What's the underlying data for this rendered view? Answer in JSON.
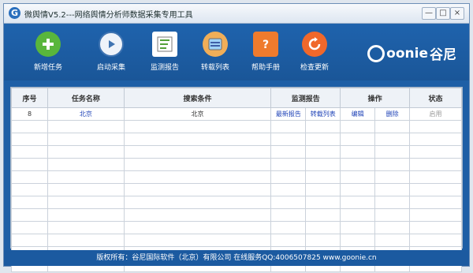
{
  "window": {
    "title": "微舆情V5.2---网络舆情分析师数据采集专用工具",
    "minimize": "—",
    "maximize": "□",
    "close": "×"
  },
  "toolbar": [
    {
      "label": "新增任务",
      "icon": "plus-icon",
      "color": "#59b63c"
    },
    {
      "label": "启动采集",
      "icon": "play-icon",
      "color": "#3f74b2"
    },
    {
      "label": "监测报告",
      "icon": "report-icon",
      "color": "#f4f4f4"
    },
    {
      "label": "转载列表",
      "icon": "list-icon",
      "color": "#f0ae58"
    },
    {
      "label": "帮助手册",
      "icon": "help-icon",
      "color": "#ef7b2d"
    },
    {
      "label": "检查更新",
      "icon": "refresh-icon",
      "color": "#f0682b"
    }
  ],
  "logo": {
    "brand": "oonie",
    "chinese": "谷尼"
  },
  "table": {
    "headers": [
      "序号",
      "任务名称",
      "搜索条件",
      "监测报告",
      "操作",
      "状态"
    ],
    "rows": [
      {
        "id": "8",
        "task_name": "北京",
        "search": "北京",
        "report_latest": "最新报告",
        "report_repost": "转载列表",
        "op_edit": "编辑",
        "op_delete": "删除",
        "status": "启用"
      }
    ]
  },
  "footer": "版权所有：谷尼国际软件（北京）有限公司 在线服务QQ:4006507825 www.goonie.cn"
}
